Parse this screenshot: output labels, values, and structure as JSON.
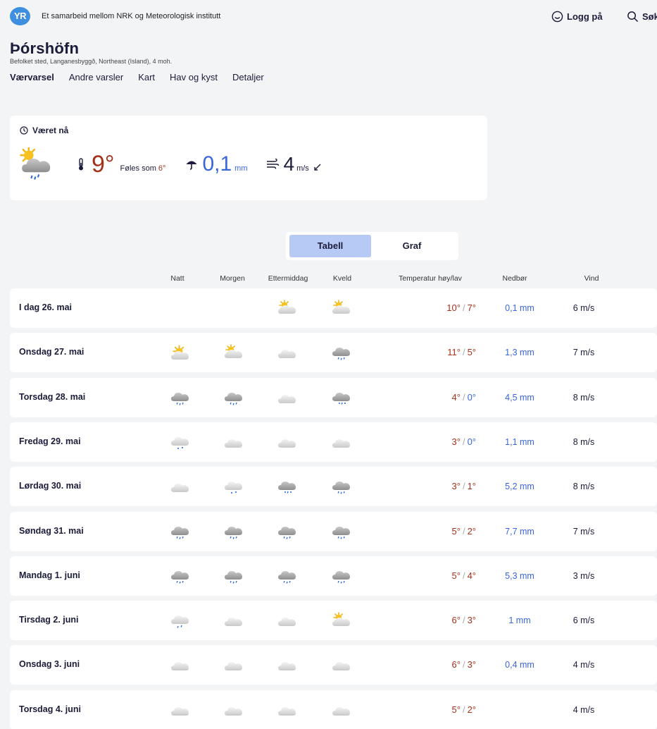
{
  "header": {
    "logo": "YR",
    "tagline": "Et samarbeid mellom NRK og Meteorologisk institutt",
    "login_label": "Logg på",
    "search_label": "Søk"
  },
  "location": {
    "name": "Þórshöfn",
    "description": "Befolket sted, Langanesbyggð, Northeast (Island), 4 moh."
  },
  "nav": {
    "tabs": [
      "Værvarsel",
      "Andre varsler",
      "Kart",
      "Hav og kyst",
      "Detaljer"
    ],
    "active": "Værvarsel"
  },
  "now": {
    "title": "Været nå",
    "temperature": "9°",
    "feels_label": "Føles som",
    "feels_value": "6°",
    "precip_value": "0,1",
    "precip_unit": "mm",
    "wind_value": "4",
    "wind_unit": "m/s",
    "icon": "partly-sunny-rain-icon"
  },
  "view_toggle": {
    "options": [
      "Tabell",
      "Graf"
    ],
    "selected": "Tabell"
  },
  "columns": [
    "Natt",
    "Morgen",
    "Ettermiddag",
    "Kveld",
    "Temperatur høy/lav",
    "Nedbør",
    "Vind"
  ],
  "forecast": [
    {
      "day": "I dag 26. mai",
      "icons": [
        "",
        "",
        "partly-cloudy",
        "partly-cloudy"
      ],
      "high": "10°",
      "low": "7°",
      "precip": "0,1 mm",
      "wind": "6 m/s"
    },
    {
      "day": "Onsdag 27. mai",
      "icons": [
        "partly-cloudy-bright",
        "partly-cloudy",
        "cloudy",
        "rain"
      ],
      "high": "11°",
      "low": "5°",
      "precip": "1,3 mm",
      "wind": "7 m/s"
    },
    {
      "day": "Torsdag 28. mai",
      "icons": [
        "rain",
        "rain",
        "cloudy",
        "sleet"
      ],
      "high": "4°",
      "low": "0°",
      "precip": "4,5 mm",
      "wind": "8 m/s"
    },
    {
      "day": "Fredag 29. mai",
      "icons": [
        "light-snow",
        "cloudy",
        "cloudy",
        "cloudy"
      ],
      "high": "3°",
      "low": "0°",
      "precip": "1,1 mm",
      "wind": "8 m/s"
    },
    {
      "day": "Lørdag 30. mai",
      "icons": [
        "cloudy",
        "light-snow",
        "sleet",
        "rain"
      ],
      "high": "3°",
      "low": "1°",
      "precip": "5,2 mm",
      "wind": "8 m/s"
    },
    {
      "day": "Søndag 31. mai",
      "icons": [
        "rain",
        "rain",
        "rain",
        "rain"
      ],
      "high": "5°",
      "low": "2°",
      "precip": "7,7 mm",
      "wind": "7 m/s"
    },
    {
      "day": "Mandag 1. juni",
      "icons": [
        "rain",
        "rain",
        "rain",
        "rain"
      ],
      "high": "5°",
      "low": "4°",
      "precip": "5,3 mm",
      "wind": "3 m/s"
    },
    {
      "day": "Tirsdag 2. juni",
      "icons": [
        "light-rain",
        "cloudy",
        "cloudy",
        "partly-cloudy"
      ],
      "high": "6°",
      "low": "3°",
      "precip": "1 mm",
      "wind": "6 m/s"
    },
    {
      "day": "Onsdag 3. juni",
      "icons": [
        "cloudy",
        "cloudy",
        "cloudy",
        "cloudy"
      ],
      "high": "6°",
      "low": "3°",
      "precip": "0,4 mm",
      "wind": "4 m/s"
    },
    {
      "day": "Torsdag 4. juni",
      "icons": [
        "cloudy",
        "cloudy",
        "cloudy",
        "cloudy"
      ],
      "high": "5°",
      "low": "2°",
      "precip": "",
      "wind": "4 m/s"
    }
  ],
  "colors": {
    "warm": "#a3311b",
    "cold": "#3b66d9",
    "toggle_selected": "#b7c9f5",
    "logo": "#3f8fe0"
  }
}
